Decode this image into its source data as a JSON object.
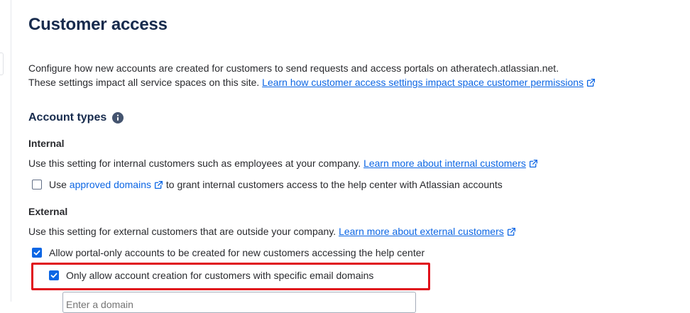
{
  "page": {
    "title": "Customer access",
    "description": {
      "line1": "Configure how new accounts are created for customers to send requests and access portals on atheratech.atlassian.net.",
      "line2_prefix": "These settings impact all service spaces on this site.",
      "line2_link": "Learn how customer access settings impact space customer permissions"
    }
  },
  "account_types": {
    "heading": "Account types",
    "info_icon": "info-icon",
    "internal": {
      "heading": "Internal",
      "description": "Use this setting for internal customers such as employees at your company.",
      "learn_more_link": "Learn more about internal customers",
      "checkbox": {
        "checked": false,
        "prefix": "Use",
        "link": "approved domains",
        "suffix": "to grant internal customers access to the help center with Atlassian accounts"
      }
    },
    "external": {
      "heading": "External",
      "description": "Use this setting for external customers that are outside your company.",
      "learn_more_link": "Learn more about external customers",
      "portal_only_checkbox": {
        "checked": true,
        "label": "Allow portal-only accounts to be created for new customers accessing the help center"
      },
      "specific_domains_checkbox": {
        "checked": true,
        "label": "Only allow account creation for customers with specific email domains"
      },
      "domain_input": {
        "placeholder": "Enter a domain"
      }
    }
  },
  "colors": {
    "link": "#0c66e4",
    "checkbox_checked": "#0c66e4",
    "highlight": "#e0101a",
    "text": "#292a2e"
  }
}
